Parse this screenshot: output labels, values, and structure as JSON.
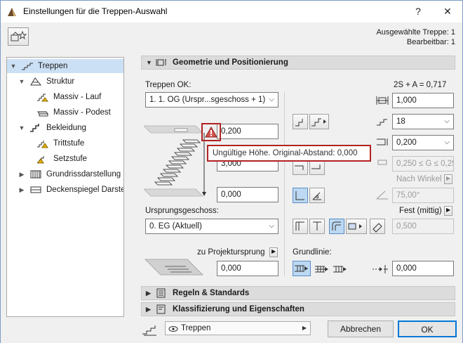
{
  "window": {
    "title": "Einstellungen für die Treppen-Auswahl",
    "help": "?",
    "close": "✕"
  },
  "info": {
    "selected": "Ausgewählte Treppe: 1",
    "editable": "Bearbeitbar: 1"
  },
  "tree": {
    "items": [
      {
        "label": "Treppen"
      },
      {
        "label": "Struktur"
      },
      {
        "label": "Massiv - Lauf"
      },
      {
        "label": "Massiv - Podest"
      },
      {
        "label": "Bekleidung"
      },
      {
        "label": "Trittstufe"
      },
      {
        "label": "Setzstufe"
      },
      {
        "label": "Grundrissdarstellung"
      },
      {
        "label": "Deckenspiegel Darste"
      }
    ]
  },
  "sections": {
    "geometry": "Geometrie und Positionierung",
    "rules": "Regeln & Standards",
    "classification": "Klassifizierung und Eigenschaften"
  },
  "geometry": {
    "top_label": "Treppen OK:",
    "top_story": "1. 1. OG (Urspr...sgeschoss + 1)",
    "top_offset": "0,200",
    "height_value": "3,000",
    "bottom_offset": "0,000",
    "origin_label": "Ursprungsgeschoss:",
    "origin_story": "0. EG (Aktuell)",
    "projection_label": "zu Projektursprung",
    "projection_value": "0,000",
    "formula": "2S + A = 0,717",
    "width_value": "1,000",
    "risers_value": "18",
    "riser_height": "0,200",
    "going_range": "0,250 ≤ G ≤ 0,25",
    "angle_mode": "Nach Winkel",
    "angle_value": "75,00°",
    "baseline_mode": "Fest (mittig)",
    "offset_value": "0,500",
    "baseline_label": "Grundlinie:",
    "baseline_offset": "0,000",
    "tooltip": "Ungültige Höhe. Original-Abstand: 0,000"
  },
  "footer": {
    "favorite": "Treppen",
    "cancel": "Abbrechen",
    "ok": "OK"
  },
  "colors": {
    "selection": "#cce0f5",
    "warning": "#b22222",
    "ok_border": "#0078d7"
  }
}
